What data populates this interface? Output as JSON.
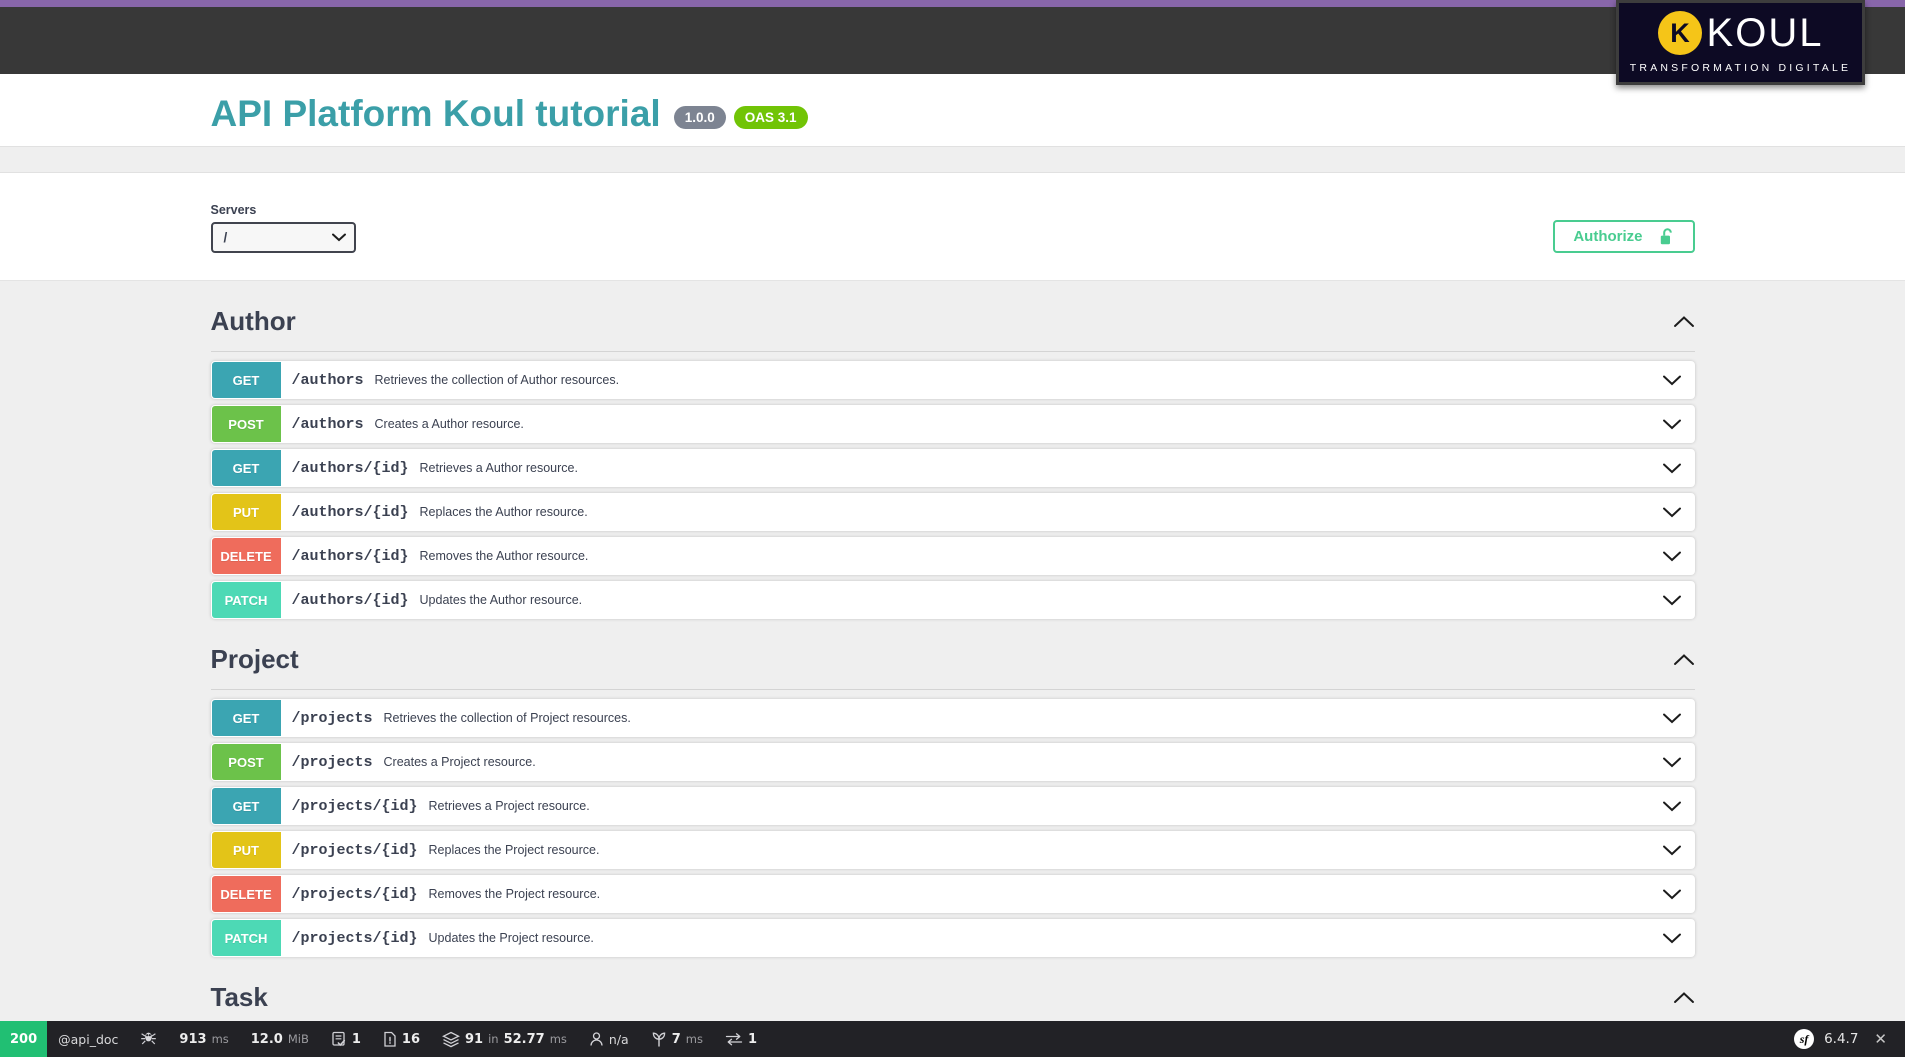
{
  "branding": {
    "logo_word": "KOUL",
    "logo_tagline": "TRANSFORMATION  DIGITALE",
    "logo_mark_letter": "K",
    "logo_mark_color": "#f5c518",
    "logo_bg_color": "#0d0a24",
    "top_strip_color": "#8866aa"
  },
  "info": {
    "title": "API Platform Koul tutorial",
    "version_badge": "1.0.0",
    "oas_badge": "OAS 3.1",
    "title_color": "#3b9fa8",
    "version_badge_color": "#7d8492",
    "oas_badge_color": "#71c406"
  },
  "scheme": {
    "servers_label": "Servers",
    "server_value": "/",
    "server_options": [
      "/"
    ],
    "authorize_label": "Authorize",
    "authorize_color": "#49cc90",
    "lock_state": "unlocked"
  },
  "tags": [
    {
      "name": "Author",
      "expanded": true,
      "operations": [
        {
          "method": "GET",
          "path": "/authors",
          "summary": "Retrieves the collection of Author resources.",
          "color": "#3ba5b2"
        },
        {
          "method": "POST",
          "path": "/authors",
          "summary": "Creates a Author resource.",
          "color": "#6cc24a"
        },
        {
          "method": "GET",
          "path": "/authors/{id}",
          "summary": "Retrieves a Author resource.",
          "color": "#3ba5b2"
        },
        {
          "method": "PUT",
          "path": "/authors/{id}",
          "summary": "Replaces the Author resource.",
          "color": "#e3c418"
        },
        {
          "method": "DELETE",
          "path": "/authors/{id}",
          "summary": "Removes the Author resource.",
          "color": "#ef6c5c"
        },
        {
          "method": "PATCH",
          "path": "/authors/{id}",
          "summary": "Updates the Author resource.",
          "color": "#4dd9b5"
        }
      ]
    },
    {
      "name": "Project",
      "expanded": true,
      "operations": [
        {
          "method": "GET",
          "path": "/projects",
          "summary": "Retrieves the collection of Project resources.",
          "color": "#3ba5b2"
        },
        {
          "method": "POST",
          "path": "/projects",
          "summary": "Creates a Project resource.",
          "color": "#6cc24a"
        },
        {
          "method": "GET",
          "path": "/projects/{id}",
          "summary": "Retrieves a Project resource.",
          "color": "#3ba5b2"
        },
        {
          "method": "PUT",
          "path": "/projects/{id}",
          "summary": "Replaces the Project resource.",
          "color": "#e3c418"
        },
        {
          "method": "DELETE",
          "path": "/projects/{id}",
          "summary": "Removes the Project resource.",
          "color": "#ef6c5c"
        },
        {
          "method": "PATCH",
          "path": "/projects/{id}",
          "summary": "Updates the Project resource.",
          "color": "#4dd9b5"
        }
      ]
    },
    {
      "name": "Task",
      "expanded": true,
      "operations": []
    }
  ],
  "debug_toolbar": {
    "status_code": "200",
    "status_color": "#21bf73",
    "route": "@api_doc",
    "crawler_icon": "spider-icon",
    "duration_value": "913",
    "duration_unit": "ms",
    "memory_value": "12.0",
    "memory_unit": "MiB",
    "forms_icon": "form-icon",
    "forms_count": "1",
    "logs_icon": "document-alert-icon",
    "logs_count": "16",
    "doctrine_icon": "database-layers-icon",
    "doctrine_queries": "91",
    "doctrine_in": "in",
    "doctrine_time": "52.77",
    "doctrine_unit": "ms",
    "user_icon": "user-icon",
    "user_value": "n/a",
    "twig_icon": "leaf-icon",
    "twig_value": "7",
    "twig_unit": "ms",
    "redirect_icon": "redirect-arrows-icon",
    "redirect_count": "1",
    "sf_logo_text": "sf",
    "sf_version": "6.4.7",
    "close_label": "✕"
  }
}
